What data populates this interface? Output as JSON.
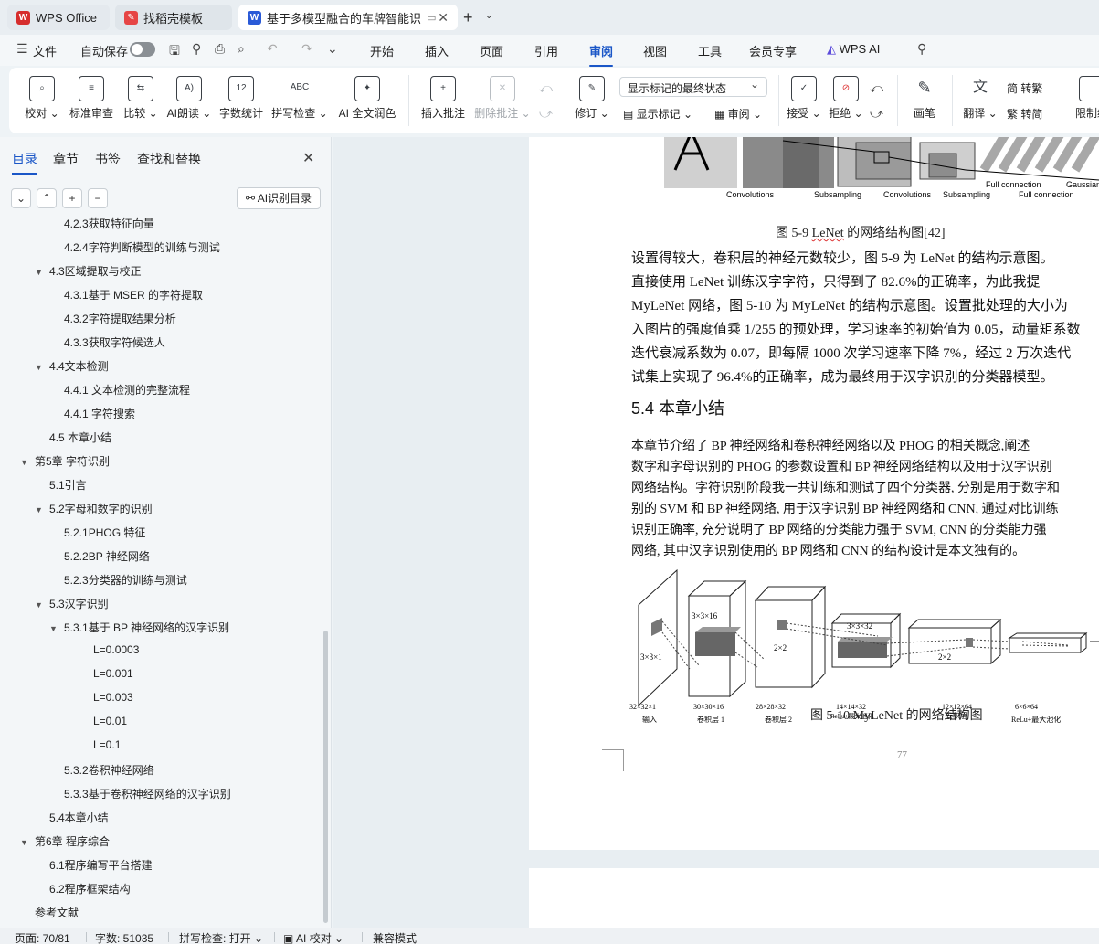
{
  "tabs": {
    "t1": "WPS Office",
    "t2": "找稻壳模板",
    "t3": "基于多模型融合的车牌智能识",
    "brand_color": "#d62d2d",
    "doc_icon_color": "#2a5ad7"
  },
  "menu": {
    "file": "文件",
    "autosave": "自动保存",
    "items": [
      "开始",
      "插入",
      "页面",
      "引用",
      "审阅",
      "视图",
      "工具",
      "会员专享",
      "WPS AI"
    ],
    "active": "审阅"
  },
  "ribbon": {
    "proof": "校对",
    "std_review": "标准审查",
    "compare": "比较",
    "ai_read": "AI朗读",
    "word_count": "字数统计",
    "spell_check": "拼写检查",
    "ai_polish": "AI 全文润色",
    "insert_comment": "插入批注",
    "delete_comment": "删除批注",
    "revise": "修订",
    "markup_state": "显示标记的最终状态",
    "show_markup": "显示标记",
    "review": "审阅",
    "accept": "接受",
    "reject": "拒绝",
    "ink": "画笔",
    "translate": "翻译",
    "to_trad": "简 转繁",
    "to_simp": "繁 转简",
    "restrict": "限制编"
  },
  "sidebar": {
    "tabs": [
      "目录",
      "章节",
      "书签",
      "查找和替换"
    ],
    "ai_toc": "AI识别目录",
    "toc": [
      {
        "t": "4.2.3获取特征向量",
        "lvl": 3
      },
      {
        "t": "4.2.4字符判断模型的训练与测试",
        "lvl": 3
      },
      {
        "t": "4.3区域提取与校正",
        "lvl": 2,
        "exp": true
      },
      {
        "t": "4.3.1基于 MSER 的字符提取",
        "lvl": 3
      },
      {
        "t": "4.3.2字符提取结果分析",
        "lvl": 3
      },
      {
        "t": "4.3.3获取字符候选人",
        "lvl": 3
      },
      {
        "t": "4.4文本检测",
        "lvl": 2,
        "exp": true
      },
      {
        "t": "4.4.1 文本检测的完整流程",
        "lvl": 3
      },
      {
        "t": "4.4.1 字符搜索",
        "lvl": 3
      },
      {
        "t": "4.5 本章小结",
        "lvl": 2
      },
      {
        "t": "第5章 字符识别",
        "lvl": 1,
        "exp": true
      },
      {
        "t": "5.1引言",
        "lvl": 2
      },
      {
        "t": "5.2字母和数字的识别",
        "lvl": 2,
        "exp": true
      },
      {
        "t": "5.2.1PHOG 特征",
        "lvl": 3
      },
      {
        "t": "5.2.2BP 神经网络",
        "lvl": 3
      },
      {
        "t": "5.2.3分类器的训练与测试",
        "lvl": 3
      },
      {
        "t": "5.3汉字识别",
        "lvl": 2,
        "exp": true
      },
      {
        "t": "5.3.1基于 BP 神经网络的汉字识别",
        "lvl": 3,
        "exp": true
      },
      {
        "t": "L=0.0003",
        "lvl": 4
      },
      {
        "t": "L=0.001",
        "lvl": 4
      },
      {
        "t": "L=0.003",
        "lvl": 4
      },
      {
        "t": "L=0.01",
        "lvl": 4
      },
      {
        "t": "L=0.1",
        "lvl": 4
      },
      {
        "t": "5.3.2卷积神经网络",
        "lvl": 3
      },
      {
        "t": "5.3.3基于卷积神经网络的汉字识别",
        "lvl": 3
      },
      {
        "t": "5.4本章小结",
        "lvl": 2
      },
      {
        "t": "第6章 程序综合",
        "lvl": 1,
        "exp": true
      },
      {
        "t": "6.1程序编写平台搭建",
        "lvl": 2
      },
      {
        "t": "6.2程序框架结构",
        "lvl": 2
      },
      {
        "t": "参考文献",
        "lvl": 1
      }
    ]
  },
  "doc": {
    "fig1_labels": [
      "Convolutions",
      "Subsampling",
      "Convolutions",
      "Subsampling",
      "Full connection",
      "Full connection",
      "Gaussian"
    ],
    "fig1_caption_a": "图 5-9 ",
    "fig1_caption_b": "LeNet",
    "fig1_caption_c": " 的网络结构图[42]",
    "lines": [
      "设置得较大，卷积层的神经元数较少，图  5-9 为  LeNet 的结构示意图。",
      "    直接使用  LeNet 训练汉字字符，只得到了  82.6%的正确率，为此我提",
      "MyLeNet 网络，图 5-10 为 MyLeNet 的结构示意图。设置批处理的大小为",
      "入图片的强度值乘  1/255 的预处理，学习速率的初始值为  0.05，动量矩系数",
      "迭代衰减系数为  0.07，即每隔  1000 次学习速率下降  7%，经过 2 万次迭代",
      "试集上实现了  96.4%的正确率，成为最终用于汉字识别的分类器模型。"
    ],
    "heading": "5.4 本章小结",
    "para2": [
      "    本章节介绍了 BP 神经网络和卷积神经网络以及 PHOG 的相关概念,阐述",
      "数字和字母识别的 PHOG 的参数设置和 BP 神经网络结构以及用于汉字识别",
      "网络结构。字符识别阶段我一共训练和测试了四个分类器, 分别是用于数字和",
      "别的 SVM 和 BP 神经网络, 用于汉字识别 BP 神经网络和 CNN, 通过对比训练",
      "识别正确率, 充分说明了 BP 网络的分类能力强于 SVM, CNN 的分类能力强",
      "网络, 其中汉字识别使用的 BP 网络和 CNN 的结构设计是本文独有的。"
    ],
    "fig2_dims": [
      "3×3×1",
      "3×3×16",
      "2×2",
      "3×3×32",
      "2×2"
    ],
    "fig2_bottom": [
      "32×32×1",
      "30×30×16",
      "28×28×32",
      "14×14×32",
      "12×12×64",
      "6×6×64"
    ],
    "fig2_bottom2": [
      "输入",
      "卷积层 1",
      "卷积层 2",
      "ReLu+最大池化",
      "卷积层",
      "ReLu+最大池化"
    ],
    "fig2_caption": "图 5-10 MyLeNet 的网络结构图",
    "page_number": "77"
  },
  "status": {
    "page": "页面: 70/81",
    "words": "字数: 51035",
    "spell": "拼写检查: 打开",
    "ai_proof": "AI 校对",
    "compat": "兼容模式"
  }
}
